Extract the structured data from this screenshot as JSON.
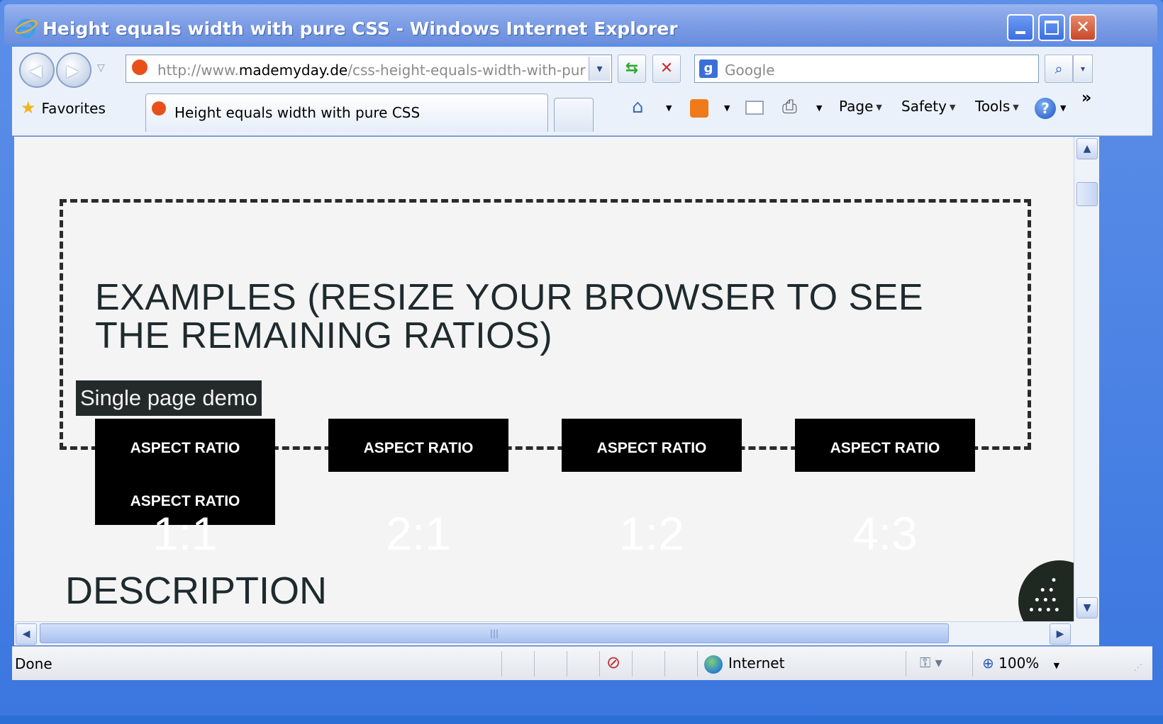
{
  "window": {
    "title": "Height equals width with pure CSS - Windows Internet Explorer",
    "minimize_label": "▁",
    "maximize_label": "☐",
    "close_label": "✕"
  },
  "toolbar": {
    "address_prefix": "http://www.",
    "address_domain": "mademyday.de",
    "address_path": "/css-height-equals-width-with-pure-cs",
    "search_placeholder": "Google",
    "favorites_label": "Favorites",
    "active_tab_label": "Height equals width with pure CSS",
    "page_menu": "Page",
    "safety_menu": "Safety",
    "tools_menu": "Tools",
    "overflow_chevron": "»"
  },
  "content": {
    "heading": "EXAMPLES (RESIZE YOUR BROWSER TO SEE THE REMAINING RATIOS)",
    "single_page_demo": "Single page demo",
    "boxes": [
      {
        "label": "ASPECT RATIO",
        "label2": "ASPECT RATIO",
        "ratio": "1:1"
      },
      {
        "label": "ASPECT RATIO",
        "ratio": "2:1"
      },
      {
        "label": "ASPECT RATIO",
        "ratio": "1:2"
      },
      {
        "label": "ASPECT RATIO",
        "ratio": "4:3"
      }
    ],
    "description_heading": "DESCRIPTION"
  },
  "statusbar": {
    "status": "Done",
    "zone": "Internet",
    "zoom": "100%"
  },
  "colors": {
    "titlebar": "#7f9fe6",
    "page_bg": "#f4f4f4",
    "box_bg": "#000000",
    "heading": "#1e2a2e",
    "demo_label_bg": "#24292a",
    "fab_bg": "#202822"
  }
}
